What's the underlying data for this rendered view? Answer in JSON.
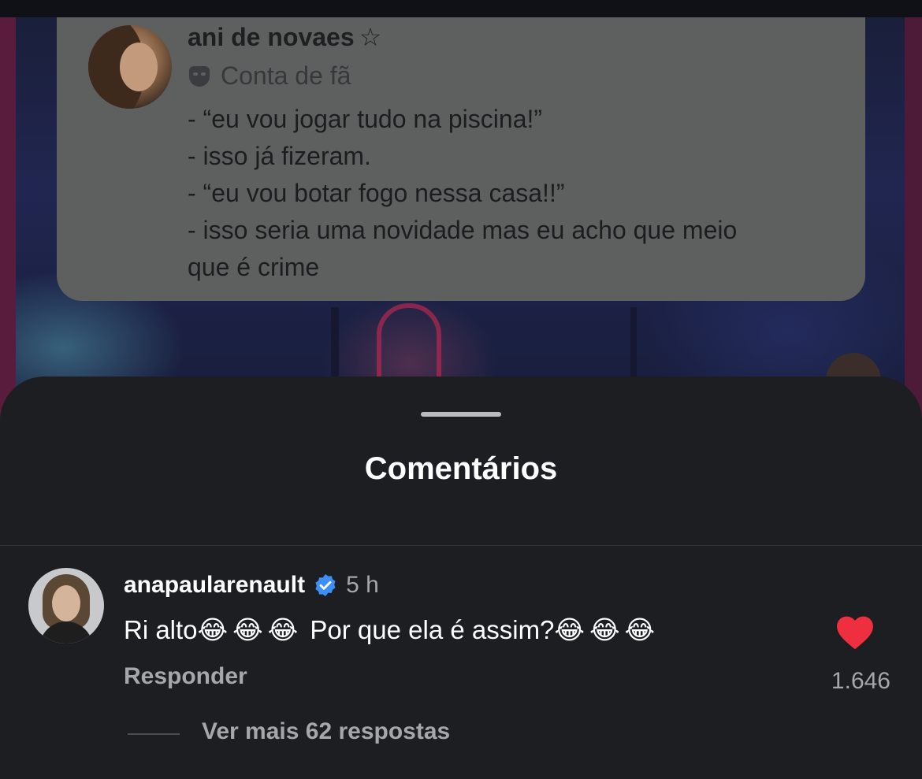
{
  "tweet": {
    "name": "ani de novaes",
    "star": "☆",
    "account_label": "Conta de fã",
    "lines": [
      "- “eu vou jogar tudo na piscina!”",
      "- isso já fizeram.",
      "- “eu vou botar fogo nessa casa!!”",
      "- isso seria uma novidade mas eu acho que meio",
      "que é crime"
    ]
  },
  "sheet": {
    "title": "Comentários",
    "comment": {
      "username": "anapaularenault",
      "verified_icon": "verified-badge-icon",
      "time": "5 h",
      "text_part1": "Ri alto",
      "emojis_1": "😂😂😂",
      "text_part2": " Por que ela é assim?",
      "emojis_2": "😂😂😂",
      "reply_label": "Responder",
      "like_icon": "heart-icon",
      "like_count": "1.646",
      "more_replies": "Ver mais 62 respostas"
    }
  },
  "colors": {
    "sheet_bg": "#1c1e22",
    "heart": "#ee2f3f",
    "verified": "#3d8ff7"
  }
}
